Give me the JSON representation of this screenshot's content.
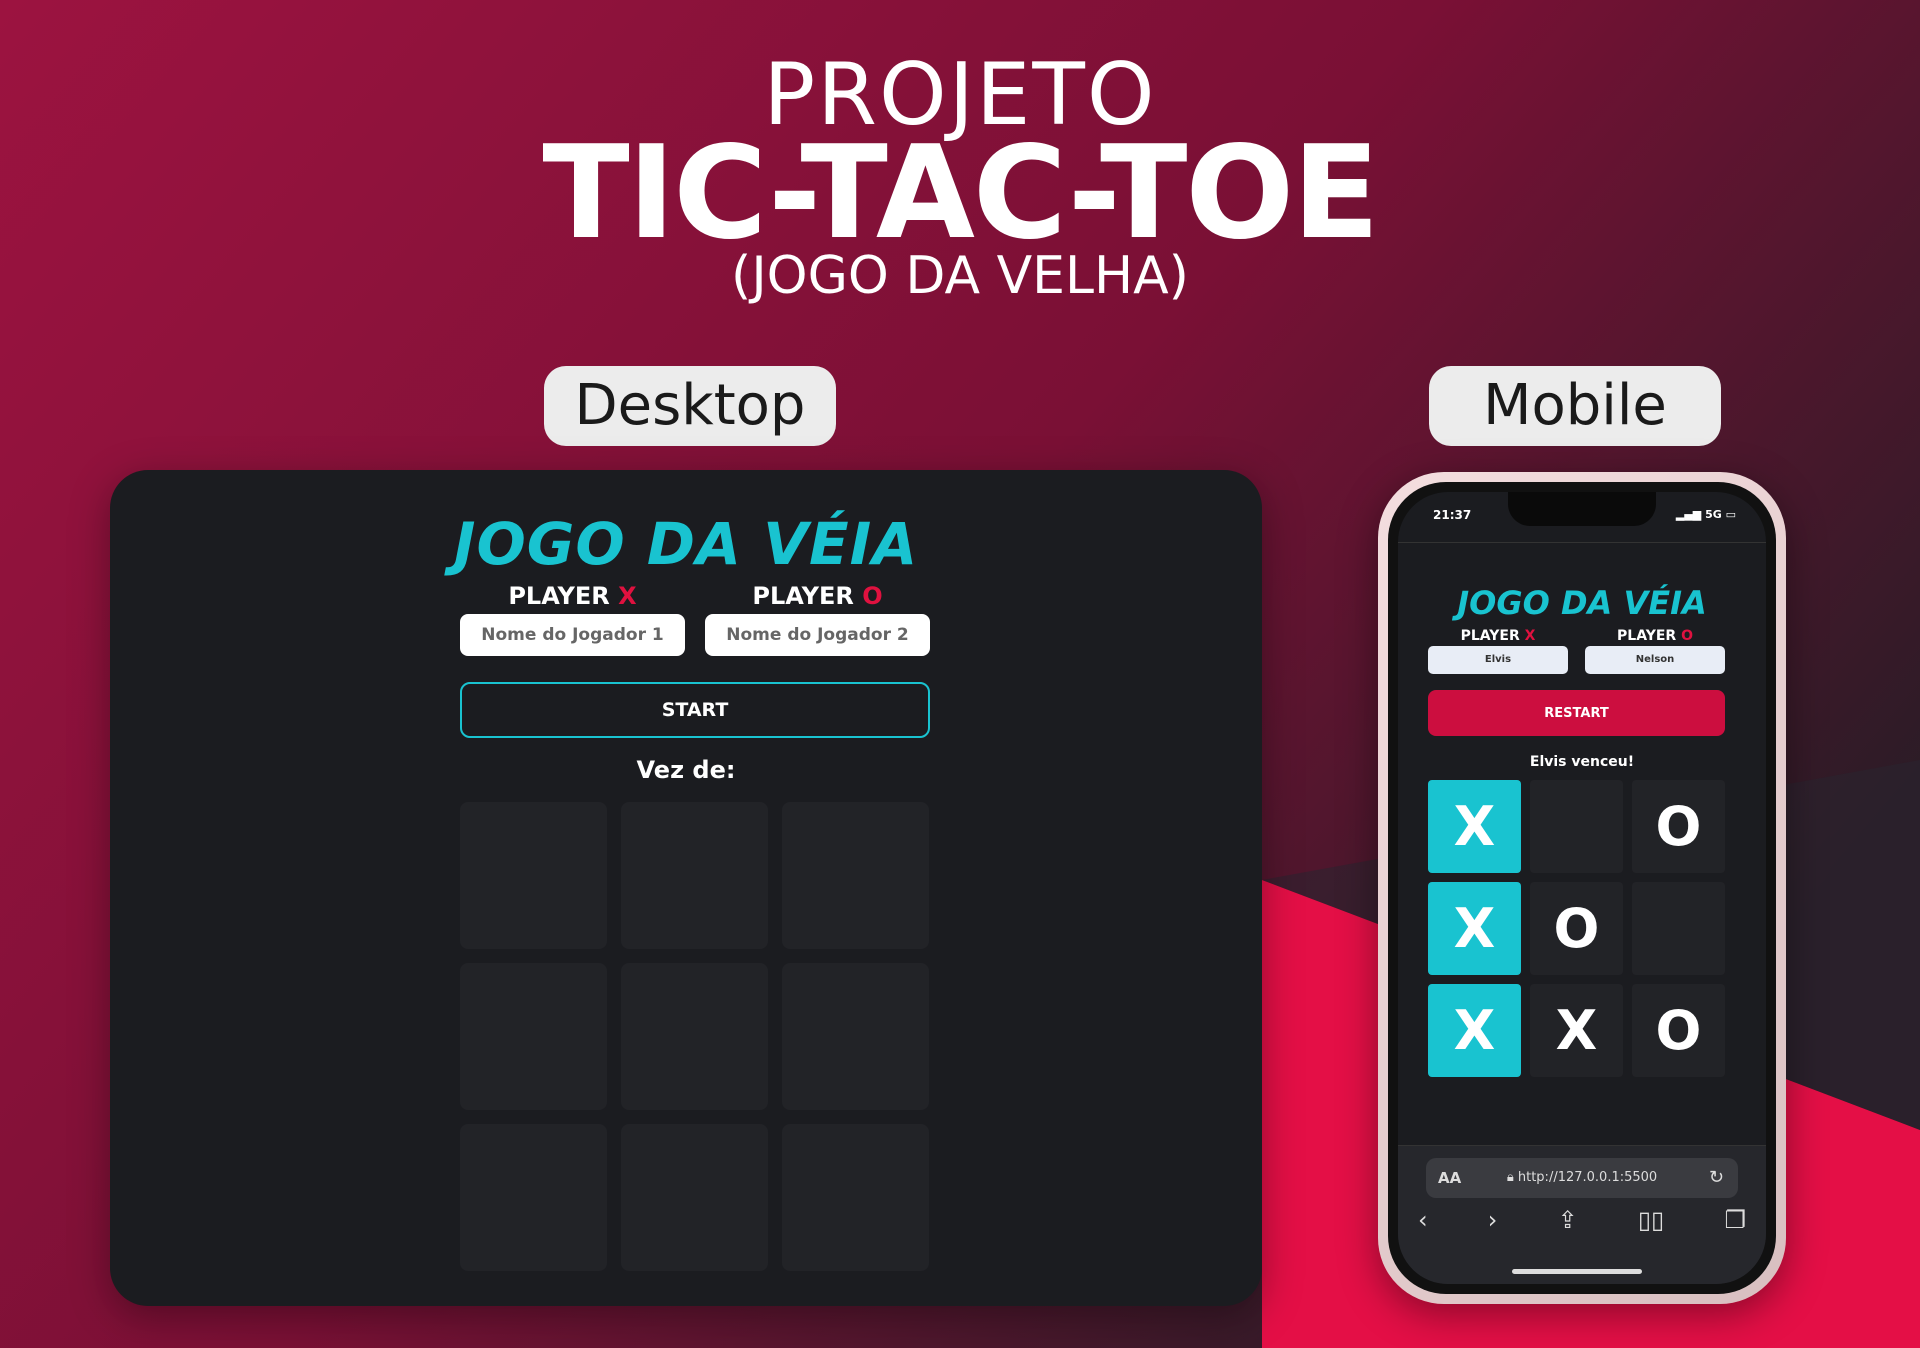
{
  "header": {
    "line1": "PROJETO",
    "line2": "TIC-TAC-TOE",
    "line3": "(JOGO DA VELHA)"
  },
  "labels": {
    "desktop": "Desktop",
    "mobile": "Mobile"
  },
  "desktop": {
    "title": "JOGO DA VÉIA",
    "player_x_label": "PLAYER",
    "player_x_mark": "X",
    "player_o_label": "PLAYER",
    "player_o_mark": "O",
    "input1_placeholder": "Nome do Jogador 1",
    "input2_placeholder": "Nome do Jogador 2",
    "start_label": "START",
    "turn_label": "Vez de:",
    "board": [
      "",
      "",
      "",
      "",
      "",
      "",
      "",
      "",
      ""
    ]
  },
  "mobile": {
    "status_time": "21:37",
    "status_right": "5G",
    "title": "JOGO DA VÉIA",
    "player_x_label": "PLAYER",
    "player_x_mark": "X",
    "player_o_label": "PLAYER",
    "player_o_mark": "O",
    "player1_name": "Elvis",
    "player2_name": "Nelson",
    "restart_label": "RESTART",
    "result": "Elvis venceu!",
    "board": [
      "X",
      "",
      "O",
      "X",
      "O",
      "",
      "X",
      "X",
      "O"
    ],
    "winning_cells": [
      0,
      3,
      6
    ],
    "url_aa": "AA",
    "url": "http://127.0.0.1:5500"
  },
  "colors": {
    "accent_cyan": "#19c3d0",
    "accent_red": "#e0113f",
    "restart_red": "#cc0e3f",
    "panel": "#1b1c20"
  },
  "icons": {
    "reload": "reload-icon",
    "back": "chevron-left-icon",
    "forward": "chevron-right-icon",
    "share": "share-icon",
    "bookmarks": "book-icon",
    "tabs": "tabs-icon",
    "lock": "lock-icon"
  }
}
